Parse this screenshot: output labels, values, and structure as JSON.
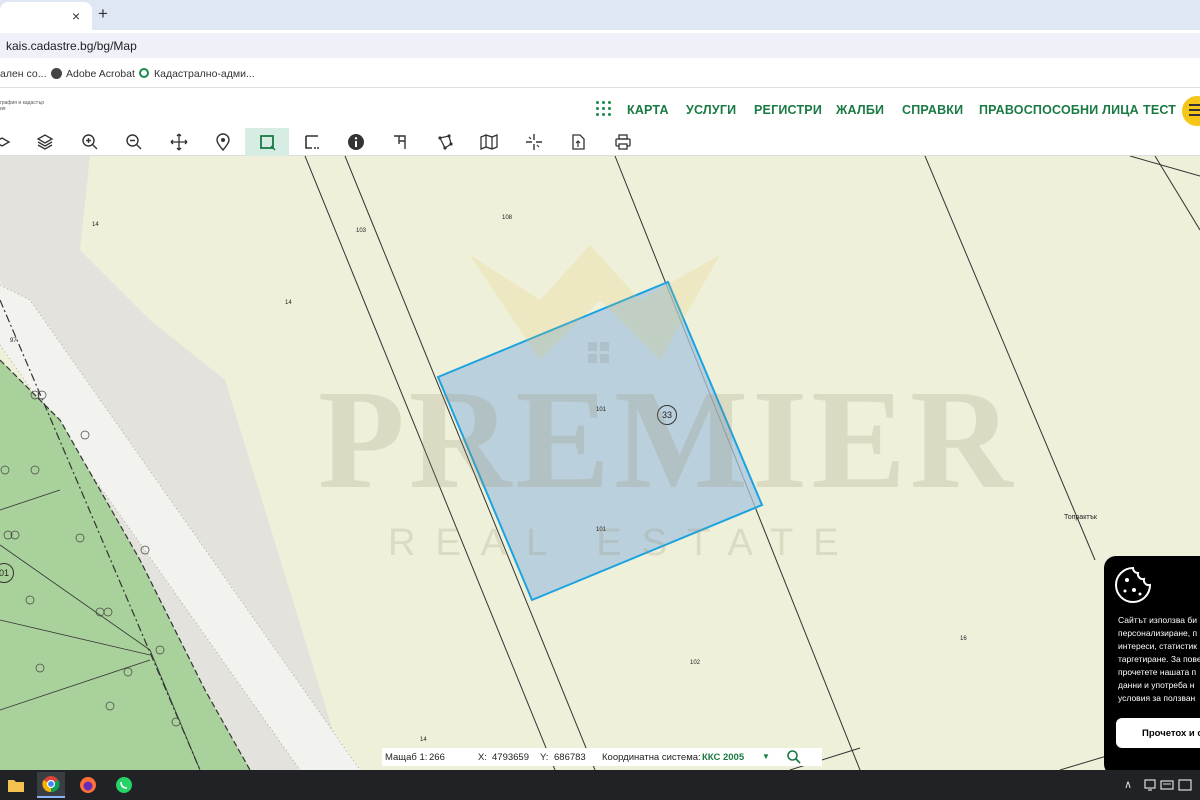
{
  "browser": {
    "tab_close": "×",
    "new_tab": "+",
    "url": "kais.cadastre.bg/bg/Map",
    "bookmarks": [
      {
        "label": "ален со..."
      },
      {
        "label": "Adobe Acrobat"
      },
      {
        "label": "Кадастрално-адми..."
      }
    ]
  },
  "site": {
    "logo_text": "графия и кадастър\nия",
    "nav": [
      {
        "label": "КАРТА"
      },
      {
        "label": "УСЛУГИ"
      },
      {
        "label": "РЕГИСТРИ"
      },
      {
        "label": "ЖАЛБИ"
      },
      {
        "label": "СПРАВКИ"
      },
      {
        "label": "ПРАВОСПОСОБНИ ЛИЦА"
      },
      {
        "label": "ТЕСТ"
      }
    ],
    "accent_color": "#1a7a43"
  },
  "toolbar": {
    "tools": [
      {
        "icon": "base-layer-icon"
      },
      {
        "icon": "layers-icon"
      },
      {
        "icon": "zoom-in-icon"
      },
      {
        "icon": "zoom-out-icon"
      },
      {
        "icon": "pan-icon"
      },
      {
        "icon": "location-pin-icon"
      },
      {
        "icon": "select-rectangle-icon",
        "active": true
      },
      {
        "icon": "select-rectangle-options-icon"
      },
      {
        "icon": "info-icon"
      },
      {
        "icon": "measure-icon"
      },
      {
        "icon": "polygon-icon"
      },
      {
        "icon": "map-icon"
      },
      {
        "icon": "crosshair-icon"
      },
      {
        "icon": "export-icon"
      },
      {
        "icon": "print-icon"
      }
    ]
  },
  "map": {
    "parcel_labels": [
      "14",
      "103",
      "108",
      "14",
      "97",
      "101",
      "101",
      "102",
      "16",
      "14"
    ],
    "place_label": "Топрактък",
    "selected_parcel_badge": "33",
    "left_badge": "01",
    "selection_color": "#1aa3e0"
  },
  "watermark": {
    "title": "PREMIER",
    "subtitle": "REAL ESTATE"
  },
  "status": {
    "scale_label": "Мащаб 1:",
    "scale_value": "266",
    "x_label": "X:",
    "x_value": "4793659",
    "y_label": "Y:",
    "y_value": "686783",
    "crs_label": "Координатна система:",
    "crs_value": "ККС 2005",
    "dropdown": "▼"
  },
  "cookie": {
    "text": "Сайтът използва би\nперсонализиране, п\nинтереси, статистик\nтаргетиране. За пове\nпрочетете нашата п\nданни и употреба н\nусловия за ползван",
    "button": "Прочетох и с"
  },
  "taskbar": {
    "tray_up": "∧"
  }
}
